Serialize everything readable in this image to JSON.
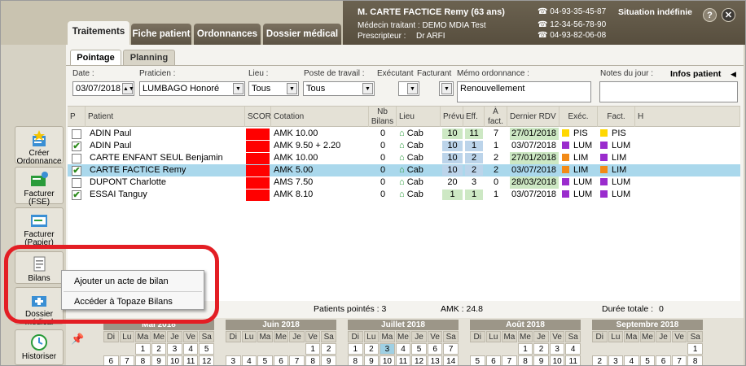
{
  "tabs": [
    "Traitements",
    "Fiche patient",
    "Ordonnances",
    "Dossier médical"
  ],
  "patient_header": {
    "name": "M. CARTE FACTICE Remy (63 ans)",
    "medecin": "Médecin traitant : DEMO MDIA Test",
    "prescripteur_label": "Prescripteur :",
    "prescripteur": "Dr ARFI",
    "phones": [
      "04-93-35-45-87",
      "12-34-56-78-90",
      "04-93-82-06-08"
    ],
    "situation": "Situation indéfinie",
    "help": "?",
    "close": "✕"
  },
  "rail": [
    {
      "label": "Créer Ordonnance",
      "icon": "create-prescription-icon"
    },
    {
      "label": "Facturer (FSE)",
      "icon": "invoice-fse-icon"
    },
    {
      "label": "Facturer (Papier)",
      "icon": "invoice-paper-icon"
    },
    {
      "label": "Bilans",
      "icon": "report-icon"
    },
    {
      "label": "Dossier médical",
      "icon": "medical-record-icon"
    },
    {
      "label": "Historiser",
      "icon": "history-icon"
    }
  ],
  "subtabs": [
    "Pointage",
    "Planning"
  ],
  "filters": {
    "date_label": "Date :",
    "date": "03/07/2018",
    "praticien_label": "Praticien :",
    "praticien": "LUMBAGO Honoré",
    "lieu_label": "Lieu :",
    "lieu": "Tous",
    "poste_label": "Poste de travail :",
    "poste": "Tous",
    "executant_label": "Exécutant",
    "facturant_label": "Facturant",
    "memo_label": "Mémo ordonnance :",
    "memo": "Renouvellement",
    "notes_label": "Notes du jour :",
    "infos": "Infos patient"
  },
  "grid": {
    "headers": [
      "P",
      "Patient",
      "SCOR",
      "Cotation",
      "Nb Bilans",
      "Lieu",
      "Prévu",
      "Eff.",
      "À fact.",
      "Dernier RDV",
      "Exéc.",
      "Fact.",
      "H"
    ],
    "rows": [
      {
        "checked": false,
        "patient": "ADIN Paul",
        "cotation": "AMK 10.00",
        "nb": "0",
        "lieu": "Cab",
        "prevu": "10",
        "eff": "11",
        "afact": "7",
        "rdv": "27/01/2018",
        "exec": "PIS",
        "fact": "PIS",
        "prevu_color": "#cde8c4",
        "rdv_color": "#cde8c4",
        "exec_color": "#ffd800",
        "fact_color": "#ffd800",
        "selected": false
      },
      {
        "checked": true,
        "patient": "ADIN Paul",
        "cotation": "AMK 9.50 + 2.20",
        "nb": "0",
        "lieu": "Cab",
        "prevu": "10",
        "eff": "1",
        "afact": "1",
        "rdv": "03/07/2018",
        "exec": "LUM",
        "fact": "LUM",
        "prevu_color": "#bcd4ea",
        "rdv_color": "#ffffff",
        "exec_color": "#9a2ccd",
        "fact_color": "#9a2ccd",
        "selected": false
      },
      {
        "checked": false,
        "patient": "CARTE ENFANT SEUL Benjamin",
        "cotation": "AMK 10.00",
        "nb": "0",
        "lieu": "Cab",
        "prevu": "10",
        "eff": "2",
        "afact": "2",
        "rdv": "27/01/2018",
        "exec": "LIM",
        "fact": "LIM",
        "prevu_color": "#bcd4ea",
        "rdv_color": "#cde8c4",
        "exec_color": "#f28a17",
        "fact_color": "#9a2ccd",
        "selected": false
      },
      {
        "checked": true,
        "patient": "CARTE FACTICE Remy",
        "cotation": "AMK 5.00",
        "nb": "0",
        "lieu": "Cab",
        "prevu": "10",
        "eff": "2",
        "afact": "2",
        "rdv": "03/07/2018",
        "exec": "LIM",
        "fact": "LIM",
        "prevu_color": "#bcd4ea",
        "rdv_color": "#aad8ec",
        "exec_color": "#f28a17",
        "fact_color": "#f28a17",
        "selected": true
      },
      {
        "checked": false,
        "patient": "DUPONT Charlotte",
        "cotation": "AMS 7.50",
        "nb": "0",
        "lieu": "Cab",
        "prevu": "20",
        "eff": "3",
        "afact": "0",
        "rdv": "28/03/2018",
        "exec": "LUM",
        "fact": "LUM",
        "prevu_color": "#ffffff",
        "rdv_color": "#cde8c4",
        "exec_color": "#9a2ccd",
        "fact_color": "#9a2ccd",
        "selected": false
      },
      {
        "checked": true,
        "patient": "ESSAI Tanguy",
        "cotation": "AMK 8.10",
        "nb": "0",
        "lieu": "Cab",
        "prevu": "1",
        "eff": "1",
        "afact": "1",
        "rdv": "03/07/2018",
        "exec": "LUM",
        "fact": "LUM",
        "prevu_color": "#cde8c4",
        "rdv_color": "#ffffff",
        "exec_color": "#9a2ccd",
        "fact_color": "#9a2ccd",
        "selected": false
      }
    ]
  },
  "footer": {
    "pointes": "Patients pointés : 3",
    "amk": "AMK : 24.8",
    "duree": "Durée totale :",
    "duree_val": "0"
  },
  "context_menu": [
    "Ajouter un acte de bilan",
    "Accéder à Topaze Bilans"
  ],
  "calendar": {
    "days": [
      "Di",
      "Lu",
      "Ma",
      "Me",
      "Je",
      "Ve",
      "Sa"
    ],
    "months": [
      {
        "name": "Mai 2018",
        "cells": [
          "",
          "",
          "1",
          "2",
          "3",
          "4",
          "5",
          "6",
          "7",
          "8",
          "9",
          "10",
          "11",
          "12"
        ]
      },
      {
        "name": "Juin 2018",
        "cells": [
          "",
          "",
          "",
          "",
          "",
          "1",
          "2",
          "3",
          "4",
          "5",
          "6",
          "7",
          "8",
          "9"
        ]
      },
      {
        "name": "Juillet 2018",
        "cells": [
          "1",
          "2",
          "3",
          "4",
          "5",
          "6",
          "7",
          "8",
          "9",
          "10",
          "11",
          "12",
          "13",
          "14"
        ]
      },
      {
        "name": "Août 2018",
        "cells": [
          "",
          "",
          "",
          "1",
          "2",
          "3",
          "4",
          "5",
          "6",
          "7",
          "8",
          "9",
          "10",
          "11"
        ]
      },
      {
        "name": "Septembre 2018",
        "cells": [
          "",
          "",
          "",
          "",
          "",
          "",
          "1",
          "2",
          "3",
          "4",
          "5",
          "6",
          "7",
          "8"
        ]
      }
    ]
  }
}
